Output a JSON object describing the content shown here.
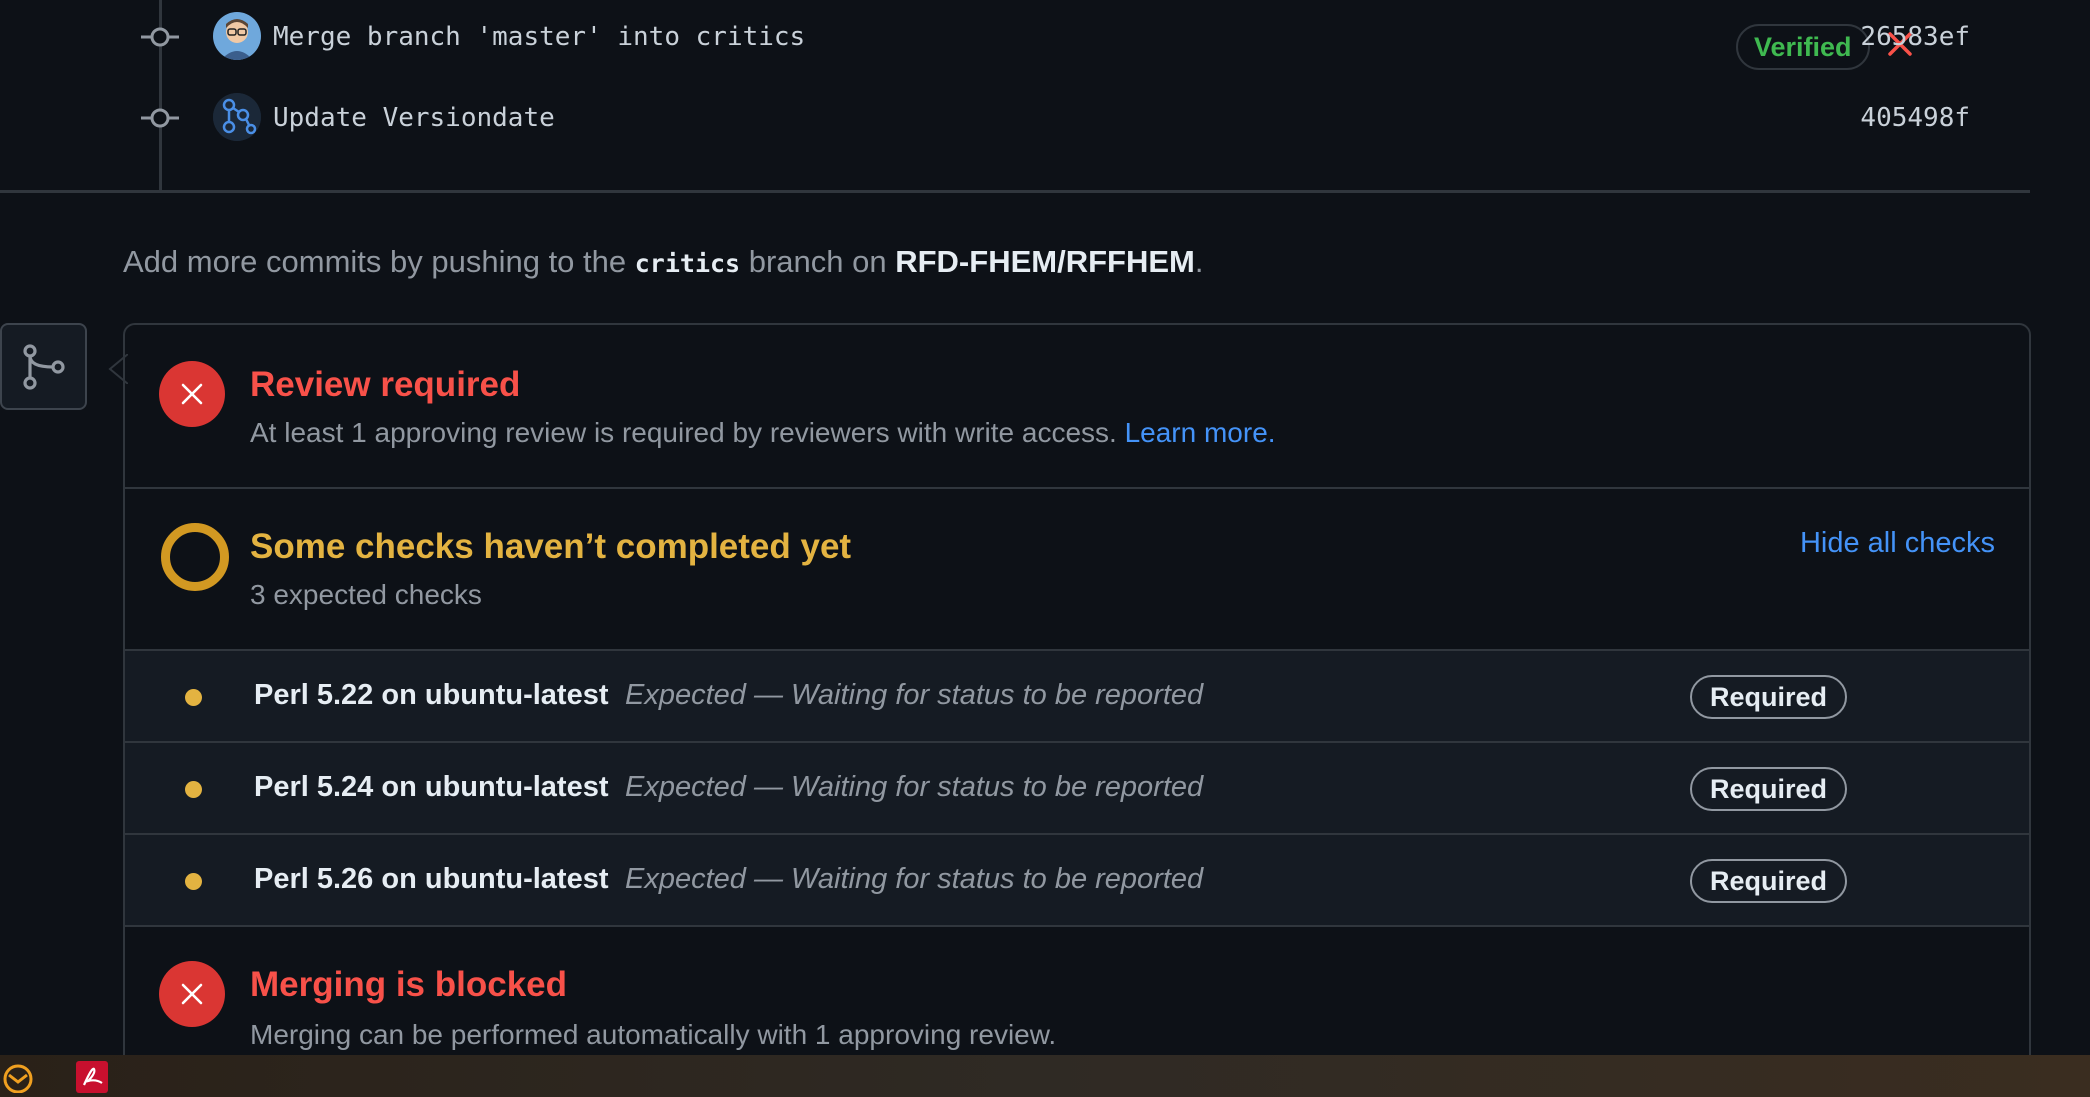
{
  "commits": [
    {
      "message": "Merge branch 'master' into critics",
      "verified": "Verified",
      "sha": "26583ef"
    },
    {
      "message": "Update Versiondate",
      "sha": "405498f"
    }
  ],
  "push_note": {
    "prefix": "Add more commits by pushing to the ",
    "branch": "critics",
    "middle": " branch on ",
    "repo": "RFD-FHEM/RFFHEM",
    "suffix": "."
  },
  "review": {
    "title": "Review required",
    "subtitle": "At least 1 approving review is required by reviewers with write access.",
    "link": "Learn more."
  },
  "checks": {
    "title": "Some checks haven’t completed yet",
    "subtitle": "3 expected checks",
    "toggle": "Hide all checks",
    "items": [
      {
        "name": "Perl 5.22 on ubuntu-latest",
        "desc": "Expected — Waiting for status to be reported",
        "badge": "Required"
      },
      {
        "name": "Perl 5.24 on ubuntu-latest",
        "desc": "Expected — Waiting for status to be reported",
        "badge": "Required"
      },
      {
        "name": "Perl 5.26 on ubuntu-latest",
        "desc": "Expected — Waiting for status to be reported",
        "badge": "Required"
      }
    ]
  },
  "merge": {
    "title": "Merging is blocked",
    "subtitle": "Merging can be performed automatically with 1 approving review."
  },
  "colors": {
    "red": "#da3633",
    "yellow": "#d29922",
    "green": "#3fb950",
    "link": "#4493f8",
    "bg": "#0d1117"
  },
  "icons": [
    "commit-node-icon",
    "x-icon",
    "git-branch-icon",
    "outlook-icon",
    "acrobat-icon"
  ]
}
